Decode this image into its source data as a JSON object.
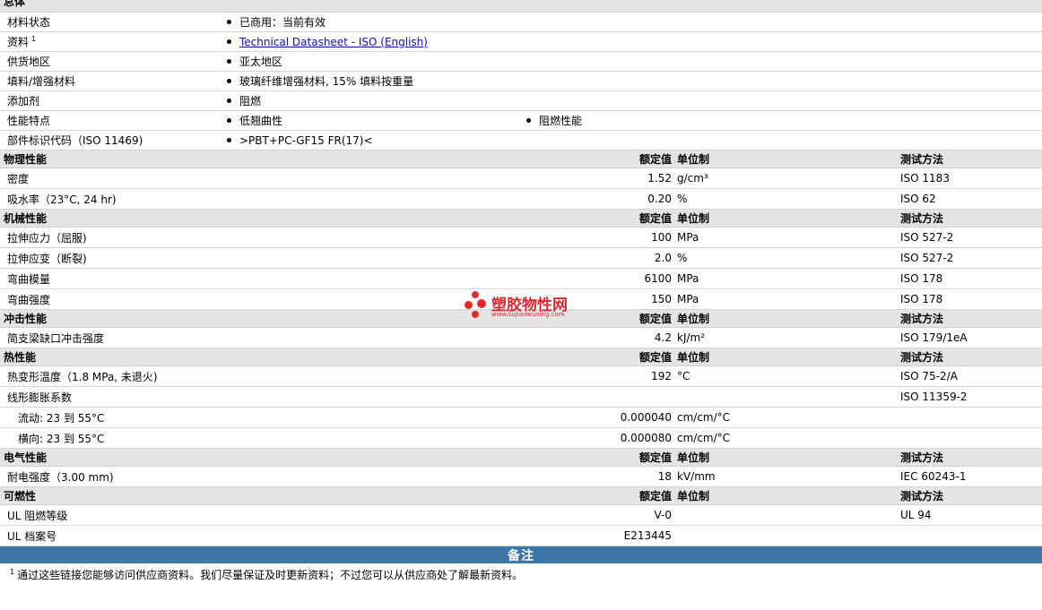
{
  "general": {
    "title": "总体",
    "rows": [
      {
        "label": "材料状态",
        "values": [
          "已商用：当前有效"
        ]
      },
      {
        "label": "资料",
        "sup": "1",
        "link": "Technical Datasheet - ISO (English)"
      },
      {
        "label": "供货地区",
        "values": [
          "亚太地区"
        ]
      },
      {
        "label": "填料/增强材料",
        "values": [
          "玻璃纤维增强材料, 15% 填料按重量"
        ]
      },
      {
        "label": "添加剂",
        "values": [
          "阻燃"
        ]
      },
      {
        "label": "性能特点",
        "values": [
          "低翘曲性",
          "阻燃性能"
        ]
      },
      {
        "label": "部件标识代码（ISO 11469)",
        "values": [
          ">PBT+PC-GF15 FR(17)<"
        ]
      }
    ]
  },
  "column_headers": {
    "value": "额定值",
    "unit": "单位制",
    "method": "测试方法"
  },
  "sections": [
    {
      "title": "物理性能",
      "rows": [
        {
          "label": "密度",
          "value": "1.52",
          "unit": "g/cm³",
          "method": "ISO 1183"
        },
        {
          "label": "吸水率（23°C, 24 hr)",
          "value": "0.20",
          "unit": "%",
          "method": "ISO 62"
        }
      ]
    },
    {
      "title": "机械性能",
      "rows": [
        {
          "label": "拉伸应力（屈服)",
          "value": "100",
          "unit": "MPa",
          "method": "ISO 527-2"
        },
        {
          "label": "拉伸应变（断裂)",
          "value": "2.0",
          "unit": "%",
          "method": "ISO 527-2"
        },
        {
          "label": "弯曲模量",
          "value": "6100",
          "unit": "MPa",
          "method": "ISO 178"
        },
        {
          "label": "弯曲强度",
          "value": "150",
          "unit": "MPa",
          "method": "ISO 178"
        }
      ]
    },
    {
      "title": "冲击性能",
      "rows": [
        {
          "label": "简支梁缺口冲击强度",
          "value": "4.2",
          "unit": "kJ/m²",
          "method": "ISO 179/1eA"
        }
      ]
    },
    {
      "title": "热性能",
      "rows": [
        {
          "label": "热变形温度（1.8 MPa, 未退火)",
          "value": "192",
          "unit": "°C",
          "method": "ISO 75-2/A"
        },
        {
          "label": "线形膨胀系数",
          "value": "",
          "unit": "",
          "method": "ISO 11359-2"
        },
        {
          "label": "流动: 23 到 55°C",
          "value": "0.000040",
          "unit": "cm/cm/°C",
          "method": "",
          "indent": true
        },
        {
          "label": "横向: 23 到 55°C",
          "value": "0.000080",
          "unit": "cm/cm/°C",
          "method": "",
          "indent": true
        }
      ]
    },
    {
      "title": "电气性能",
      "rows": [
        {
          "label": "耐电强度（3.00 mm)",
          "value": "18",
          "unit": "kV/mm",
          "method": "IEC 60243-1"
        }
      ]
    },
    {
      "title": "可燃性",
      "rows": [
        {
          "label": "UL 阻燃等级",
          "value": "V-0",
          "unit": "",
          "method": "UL 94"
        },
        {
          "label": "UL 档案号",
          "value": "E213445",
          "unit": "",
          "method": ""
        }
      ]
    }
  ],
  "notes": {
    "title": "备注",
    "footnote_mark": "1",
    "footnote_text": "通过这些链接您能够访问供应商资料。我们尽量保证及时更新资料；不过您可以从供应商处了解最新资料。"
  },
  "watermark": {
    "name": "塑胶物性网",
    "url": "www.sujiaowuxing.com",
    "color": "#d9282f"
  }
}
